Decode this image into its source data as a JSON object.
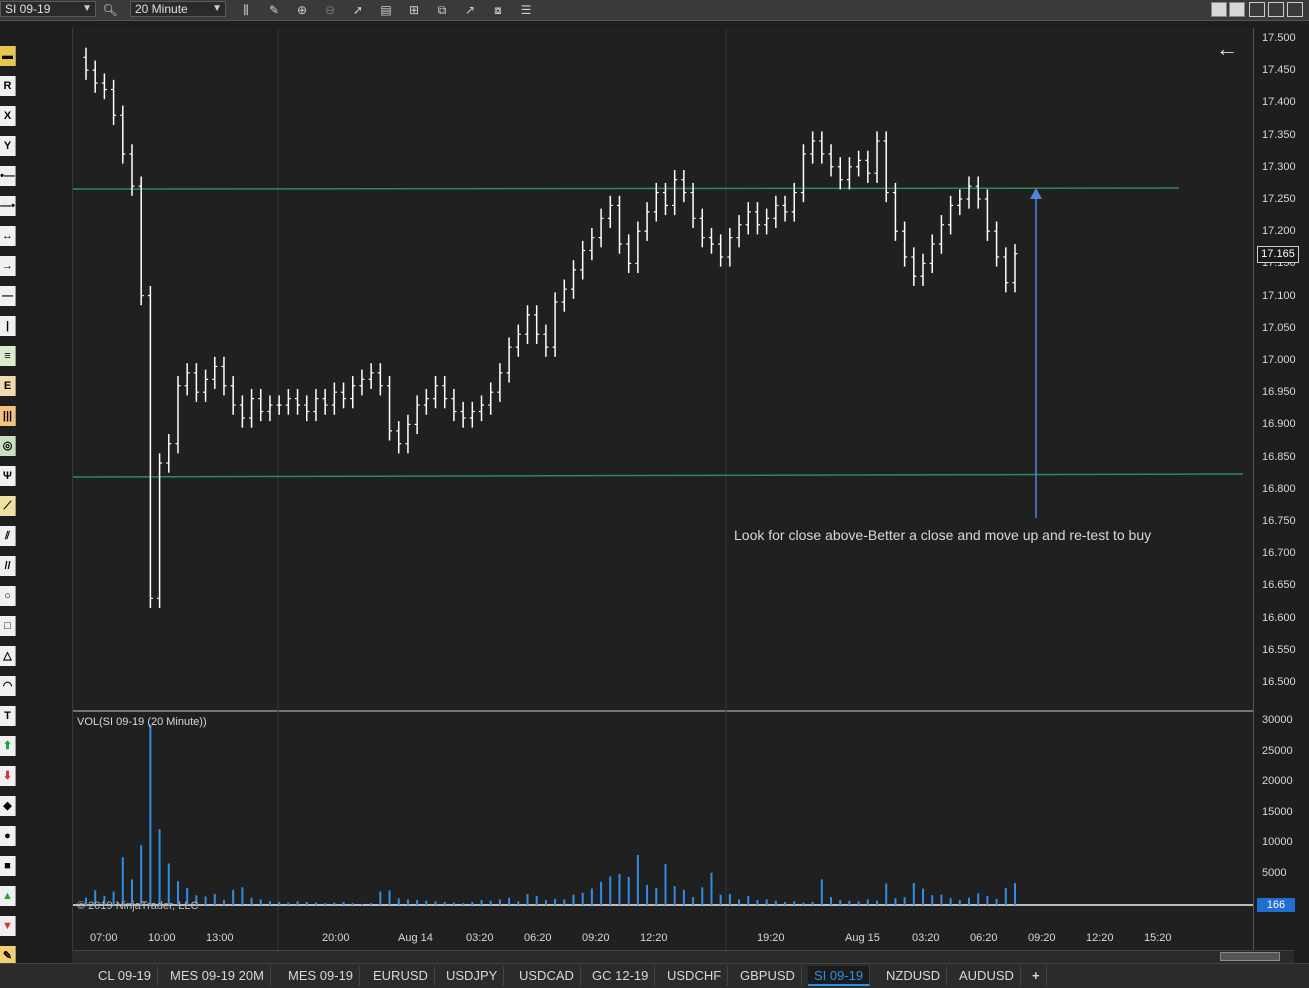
{
  "toolbar": {
    "instrument": "SI 09-19",
    "interval": "20 Minute"
  },
  "chart": {
    "annotation": "Look for close above-Better a close and move up and re-test to buy",
    "volume_label": "VOL(SI 09-19 (20 Minute))",
    "copyright": "© 2019 NinjaTrader, LLC",
    "last_price": "17.165",
    "last_volume": "166"
  },
  "price_axis": [
    "17.500",
    "17.450",
    "17.400",
    "17.350",
    "17.300",
    "17.250",
    "17.200",
    "17.150",
    "17.100",
    "17.050",
    "17.000",
    "16.950",
    "16.900",
    "16.850",
    "16.800",
    "16.750",
    "16.700",
    "16.650",
    "16.600",
    "16.550",
    "16.500"
  ],
  "volume_axis": [
    "30000",
    "25000",
    "20000",
    "15000",
    "10000",
    "5000"
  ],
  "time_axis": [
    "07:00",
    "10:00",
    "13:00",
    "20:00",
    "Aug 14",
    "03:20",
    "06:20",
    "09:20",
    "12:20",
    "19:20",
    "Aug 15",
    "03:20",
    "06:20",
    "09:20",
    "12:20",
    "15:20"
  ],
  "tabs": [
    "CL 09-19",
    "MES 09-19 20M",
    "MES 09-19",
    "EURUSD",
    "USDJPY",
    "USDCAD",
    "GC 12-19",
    "USDCHF",
    "GBPUSD",
    "SI 09-19",
    "NZDUSD",
    "AUDUSD"
  ],
  "active_tab": "SI 09-19",
  "colors": {
    "background": "#202020",
    "bars": "#ffffff",
    "horizontal_lines": "#2e8b57",
    "arrow": "#4f86d9",
    "volume": "#2f8fe8",
    "active_tab": "#2f8fe8"
  },
  "chart_data": {
    "type": "bar",
    "title": "SI 09-19 (20 Minute)",
    "price_range": [
      16.48,
      17.52
    ],
    "volume_range": [
      0,
      31000
    ],
    "horizontal_levels": [
      17.267,
      16.823
    ],
    "last_price": 17.165,
    "ohlc_close_path": [
      17.45,
      17.43,
      17.42,
      17.38,
      17.32,
      17.27,
      17.1,
      16.63,
      16.84,
      16.87,
      16.96,
      16.98,
      16.95,
      16.97,
      16.99,
      16.96,
      16.93,
      16.91,
      16.94,
      16.92,
      16.93,
      16.93,
      16.94,
      16.93,
      16.92,
      16.94,
      16.93,
      16.95,
      16.94,
      16.96,
      16.97,
      16.98,
      16.96,
      16.89,
      16.87,
      16.9,
      16.93,
      16.94,
      16.96,
      16.94,
      16.92,
      16.91,
      16.92,
      16.93,
      16.95,
      16.98,
      17.02,
      17.04,
      17.07,
      17.04,
      17.02,
      17.09,
      17.11,
      17.14,
      17.17,
      17.19,
      17.22,
      17.24,
      17.18,
      17.15,
      17.2,
      17.23,
      17.26,
      17.24,
      17.28,
      17.26,
      17.22,
      17.19,
      17.18,
      17.16,
      17.19,
      17.21,
      17.23,
      17.21,
      17.22,
      17.24,
      17.23,
      17.26,
      17.32,
      17.34,
      17.32,
      17.3,
      17.28,
      17.3,
      17.31,
      17.29,
      17.34,
      17.26,
      17.2,
      17.16,
      17.13,
      17.15,
      17.18,
      17.21,
      17.24,
      17.25,
      17.27,
      17.25,
      17.2,
      17.16,
      17.12,
      17.165
    ],
    "volume_values": [
      1200,
      2400,
      1500,
      2200,
      7800,
      4200,
      9800,
      29500,
      12400,
      6800,
      3900,
      2800,
      1600,
      1400,
      1800,
      800,
      2500,
      2900,
      1200,
      900,
      600,
      500,
      400,
      600,
      500,
      400,
      300,
      400,
      500,
      300,
      200,
      300,
      2200,
      2400,
      1100,
      900,
      800,
      700,
      600,
      500,
      400,
      300,
      500,
      800,
      700,
      900,
      1200,
      600,
      1800,
      1500,
      800,
      1000,
      900,
      1700,
      2000,
      2700,
      3800,
      4700,
      5100,
      4600,
      8200,
      3300,
      2800,
      6700,
      3100,
      2500,
      1300,
      2900,
      5300,
      1700,
      1800,
      900,
      1500,
      800,
      900,
      700,
      500,
      600,
      400,
      500,
      4200,
      1300,
      800,
      700,
      600,
      900,
      700,
      3500,
      1100,
      1300,
      3600,
      2700,
      1600,
      1700,
      1100,
      800,
      1200,
      1900,
      1500,
      1000,
      2800,
      3600
    ]
  }
}
